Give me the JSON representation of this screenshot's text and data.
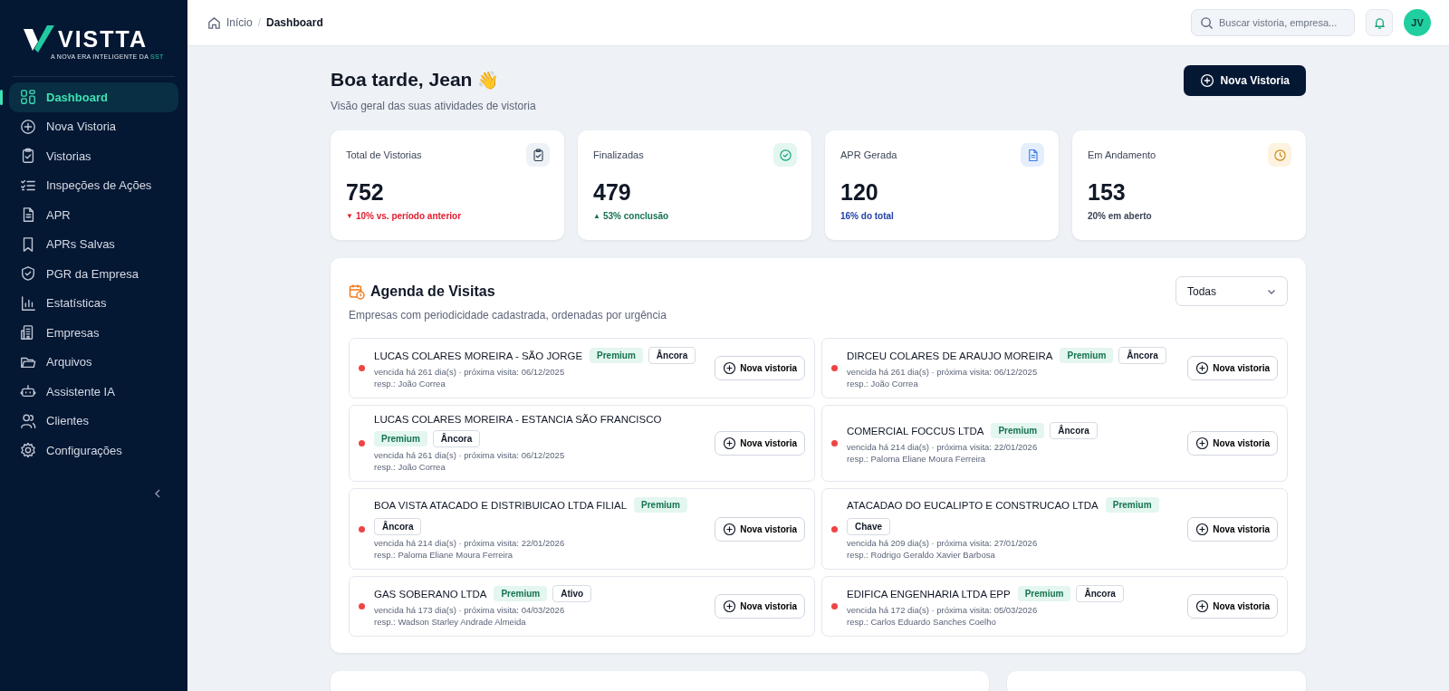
{
  "sidebar": {
    "logo": "VISTTA",
    "tagline_main": "A NOVA ERA INTELIGENTE DA ",
    "tagline_accent": "SST",
    "items": [
      {
        "label": "Dashboard",
        "selected": true
      },
      {
        "label": "Nova Vistoria",
        "selected": false
      },
      {
        "label": "Vistorias",
        "selected": false
      },
      {
        "label": "Inspeções de Ações",
        "selected": false
      },
      {
        "label": "APR",
        "selected": false
      },
      {
        "label": "APRs Salvas",
        "selected": false
      },
      {
        "label": "PGR da Empresa",
        "selected": false
      },
      {
        "label": "Estatísticas",
        "selected": false
      },
      {
        "label": "Empresas",
        "selected": false
      },
      {
        "label": "Arquivos",
        "selected": false
      },
      {
        "label": "Assistente IA",
        "selected": false
      },
      {
        "label": "Clientes",
        "selected": false
      },
      {
        "label": "Configurações",
        "selected": false
      }
    ]
  },
  "header": {
    "breadcrumb": [
      "Início",
      "Dashboard"
    ],
    "breadcrumb_separator": "/",
    "search": {
      "placeholder": "Buscar vistoria, empresa..."
    },
    "avatar": "JV"
  },
  "greeting": {
    "title": "Boa tarde, Jean",
    "emoji": "👋",
    "subtitle": "Visão geral das suas atividades de vistoria",
    "button": "Nova Vistoria"
  },
  "stats": [
    {
      "label": "Total de Vistorias",
      "value": "752",
      "arrow": "▼",
      "note": "10% vs. período anterior",
      "kind": "down"
    },
    {
      "label": "Finalizadas",
      "value": "479",
      "arrow": "▲",
      "note": "53% conclusão",
      "kind": "up"
    },
    {
      "label": "APR Gerada",
      "value": "120",
      "note": "16% do total",
      "kind": "info"
    },
    {
      "label": "Em Andamento",
      "value": "153",
      "note": "20% em aberto",
      "kind": "plain"
    }
  ],
  "agenda": {
    "title": "Agenda de Visitas",
    "subtitle": "Empresas com periodicidade cadastrada, ordenadas por urgência",
    "filter": "Todas",
    "visits": [
      {
        "name": "LUCAS COLARES MOREIRA - SÃO JORGE",
        "tags": [
          {
            "label": "Premium",
            "kind": "premium"
          },
          {
            "label": "Âncora",
            "kind": "outline"
          }
        ],
        "due": "vencida há 261 dia(s) · próxima visita: 06/12/2025",
        "resp": "resp.: João Correa",
        "color": "#ef4444",
        "button": "Nova vistoria"
      },
      {
        "name": "DIRCEU COLARES DE ARAUJO MOREIRA",
        "tags": [
          {
            "label": "Premium",
            "kind": "premium"
          },
          {
            "label": "Âncora",
            "kind": "outline"
          }
        ],
        "due": "vencida há 261 dia(s) · próxima visita: 06/12/2025",
        "resp": "resp.: João Correa",
        "color": "#ef4444",
        "button": "Nova vistoria"
      },
      {
        "name": "LUCAS COLARES MOREIRA - ESTANCIA SÃO FRANCISCO",
        "tags": [
          {
            "label": "Premium",
            "kind": "premium"
          },
          {
            "label": "Âncora",
            "kind": "outline"
          }
        ],
        "due": "vencida há 261 dia(s) · próxima visita: 06/12/2025",
        "resp": "resp.: João Correa",
        "color": "#ef4444",
        "button": "Nova vistoria"
      },
      {
        "name": "COMERCIAL FOCCUS LTDA",
        "tags": [
          {
            "label": "Premium",
            "kind": "premium"
          },
          {
            "label": "Âncora",
            "kind": "outline"
          }
        ],
        "due": "vencida há 214 dia(s) · próxima visita: 22/01/2026",
        "resp": "resp.: Paloma Eliane Moura Ferreira",
        "color": "#ef4444",
        "button": "Nova vistoria"
      },
      {
        "name": "BOA VISTA ATACADO E DISTRIBUICAO LTDA FILIAL",
        "tags": [
          {
            "label": "Premium",
            "kind": "premium"
          },
          {
            "label": "Âncora",
            "kind": "outline"
          }
        ],
        "due": "vencida há 214 dia(s) · próxima visita: 22/01/2026",
        "resp": "resp.: Paloma Eliane Moura Ferreira",
        "color": "#ef4444",
        "button": "Nova vistoria"
      },
      {
        "name": "ATACADAO DO EUCALIPTO E CONSTRUCAO LTDA",
        "tags": [
          {
            "label": "Premium",
            "kind": "premium"
          },
          {
            "label": "Chave",
            "kind": "outline"
          }
        ],
        "due": "vencida há 209 dia(s) · próxima visita: 27/01/2026",
        "resp": "resp.: Rodrigo Geraldo Xavier Barbosa",
        "color": "#ef4444",
        "button": "Nova vistoria"
      },
      {
        "name": "GAS SOBERANO LTDA",
        "tags": [
          {
            "label": "Premium",
            "kind": "premium"
          },
          {
            "label": "Ativo",
            "kind": "outline"
          }
        ],
        "due": "vencida há 173 dia(s) · próxima visita: 04/03/2026",
        "resp": "resp.: Wadson Starley Andrade Almeida",
        "color": "#ef4444",
        "button": "Nova vistoria"
      },
      {
        "name": "EDIFICA ENGENHARIA LTDA EPP",
        "tags": [
          {
            "label": "Premium",
            "kind": "premium"
          },
          {
            "label": "Âncora",
            "kind": "outline"
          }
        ],
        "due": "vencida há 172 dia(s) · próxima visita: 05/03/2026",
        "resp": "resp.: Carlos Eduardo Sanches Coelho",
        "color": "#ef4444",
        "button": "Nova vistoria"
      }
    ]
  }
}
